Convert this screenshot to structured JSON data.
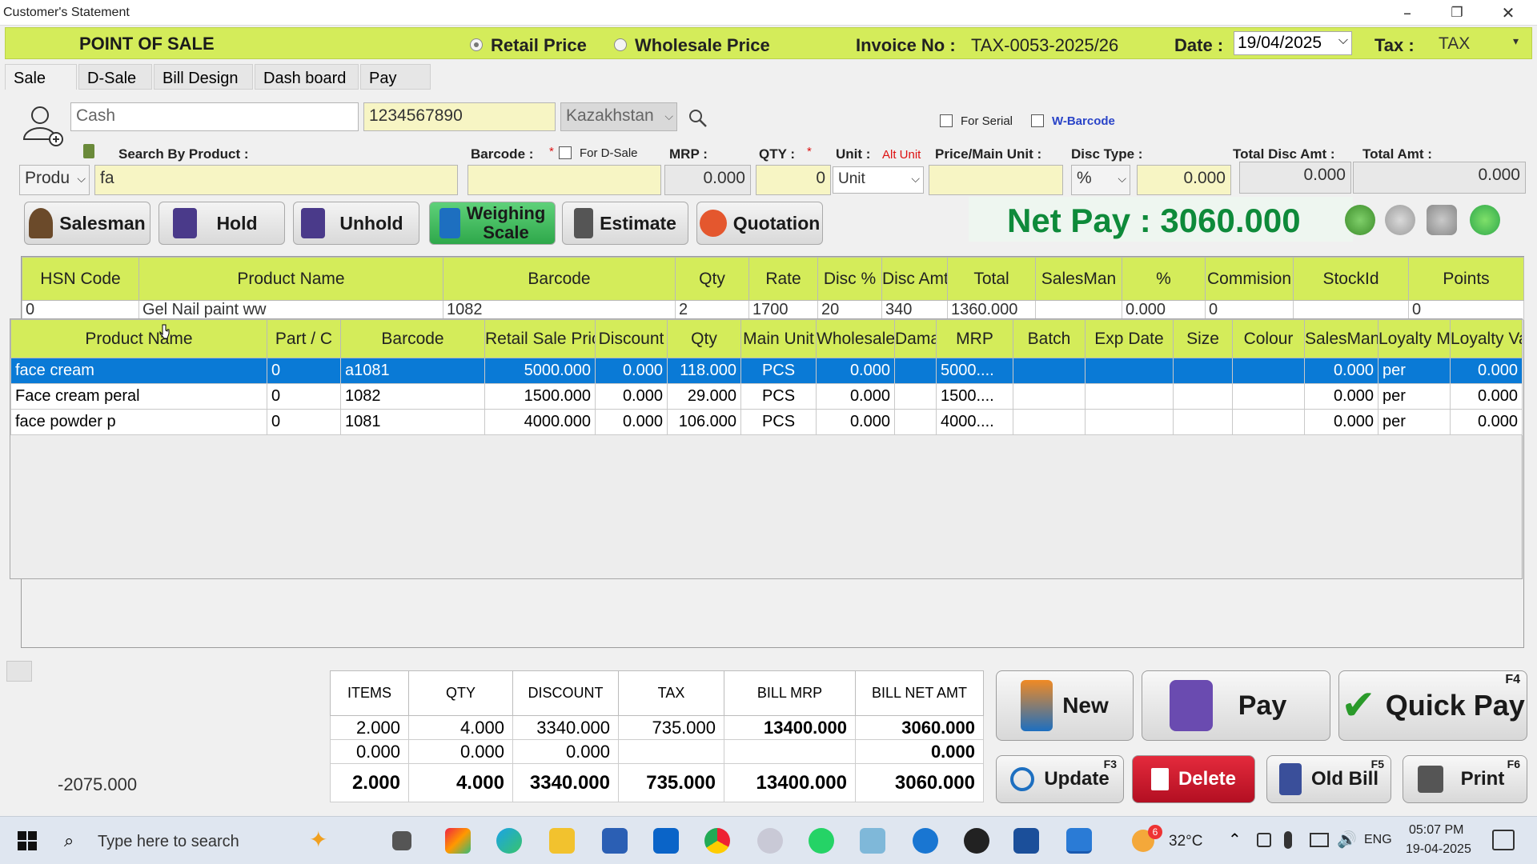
{
  "window": {
    "title": "Customer's Statement",
    "minimize": "–",
    "restore": "❐",
    "close": "✕"
  },
  "header": {
    "title": "POINT OF SALE",
    "retail_price": "Retail Price",
    "wholesale_price": "Wholesale Price",
    "invoice_label": "Invoice No :",
    "invoice_value": "TAX-0053-2025/26",
    "date_label": "Date :",
    "date_value": "19/04/2025",
    "tax_label": "Tax :",
    "tax_value": "TAX"
  },
  "tabs": [
    "Sale",
    "D-Sale",
    "Bill Design",
    "Dash board",
    "Pay"
  ],
  "customer": {
    "name": "Cash",
    "phone": "1234567890",
    "country": "Kazakhstan"
  },
  "options": {
    "for_serial": "For Serial",
    "w_barcode": "W-Barcode",
    "for_dsale": "For D-Sale"
  },
  "labels": {
    "search_by_product": "Search By Product :",
    "barcode": "Barcode :",
    "mrp": "MRP :",
    "qty": "QTY :",
    "unit": "Unit :",
    "alt_unit": "Alt Unit",
    "price_main_unit": "Price/Main Unit :",
    "disc_type": "Disc Type :",
    "total_disc_amt": "Total Disc Amt :",
    "total_amt": "Total Amt :",
    "required": "*"
  },
  "entry": {
    "search_type": "Produ",
    "search_text": "fa",
    "barcode": "",
    "mrp": "0.000",
    "qty": "0",
    "unit": "Unit",
    "price": "",
    "disc_type": "%",
    "disc_value": "0.000",
    "total_disc": "0.000",
    "total_amt": "0.000"
  },
  "buttons": {
    "salesman": "Salesman",
    "hold": "Hold",
    "unhold": "Unhold",
    "weighing_line1": "Weighing",
    "weighing_line2": "Scale",
    "estimate": "Estimate",
    "quotation": "Quotation"
  },
  "net_pay": "Net Pay : 3060.000",
  "grid": {
    "headers": [
      "HSN Code",
      "Product Name",
      "Barcode",
      "Qty",
      "Rate",
      "Disc %",
      "Disc Amt",
      "Total",
      "SalesMan",
      "%",
      "Commision",
      "StockId",
      "Points"
    ],
    "row": [
      "0",
      "Gel Nail paint ww",
      "1082",
      "2",
      "1700",
      "20",
      "340",
      "1360.000",
      "",
      "0.000",
      "0",
      "",
      "0"
    ]
  },
  "popup": {
    "headers": [
      "Product Name",
      "Part / C",
      "Barcode",
      "Retail Sale Price",
      "Discount",
      "Qty",
      "Main Unit",
      "Wholesale Sale",
      "Damage Qty",
      "MRP",
      "Batch",
      "Exp Date",
      "Size",
      "Colour",
      "SalesMan",
      "Loyalty Mode",
      "Loyalty Value"
    ],
    "rows": [
      [
        "face cream",
        "0",
        "a1081",
        "5000.000",
        "0.000",
        "118.000",
        "PCS",
        "0.000",
        "",
        "5000....",
        "",
        "",
        "",
        "",
        "0.000",
        "per",
        "0.000"
      ],
      [
        "Face cream peral",
        "0",
        "1082",
        "1500.000",
        "0.000",
        "29.000",
        "PCS",
        "0.000",
        "",
        "1500....",
        "",
        "",
        "",
        "",
        "0.000",
        "per",
        "0.000"
      ],
      [
        "face powder p",
        "0",
        "1081",
        "4000.000",
        "0.000",
        "106.000",
        "PCS",
        "0.000",
        "",
        "4000....",
        "",
        "",
        "",
        "",
        "0.000",
        "per",
        "0.000"
      ]
    ]
  },
  "summary": {
    "headers": [
      "ITEMS",
      "QTY",
      "DISCOUNT",
      "TAX",
      "BILL MRP",
      "BILL NET AMT"
    ],
    "rows": [
      [
        "2.000",
        "4.000",
        "3340.000",
        "735.000",
        "13400.000",
        "3060.000"
      ],
      [
        "0.000",
        "0.000",
        "0.000",
        "",
        "",
        "0.000"
      ],
      [
        "2.000",
        "4.000",
        "3340.000",
        "735.000",
        "13400.000",
        "3060.000"
      ]
    ]
  },
  "balance": "-2075.000",
  "actions": {
    "new": "New",
    "pay": "Pay",
    "quick_pay": "Quick Pay",
    "quick_pay_key": "F4",
    "update": "Update",
    "update_key": "F3",
    "delete": "Delete",
    "old_bill": "Old Bill",
    "old_bill_key": "F5",
    "print": "Print",
    "print_key": "F6"
  },
  "taskbar": {
    "search_placeholder": "Type here to search",
    "temperature": "32°C",
    "lang": "ENG",
    "time": "05:07 PM",
    "date": "19-04-2025",
    "weather_badge": "6"
  },
  "colors": {
    "accent_yellow": "#d4ec5a",
    "net_pay_green": "#0e8a3a",
    "selection_blue": "#0a7ad6",
    "delete_red": "#c8102e"
  }
}
